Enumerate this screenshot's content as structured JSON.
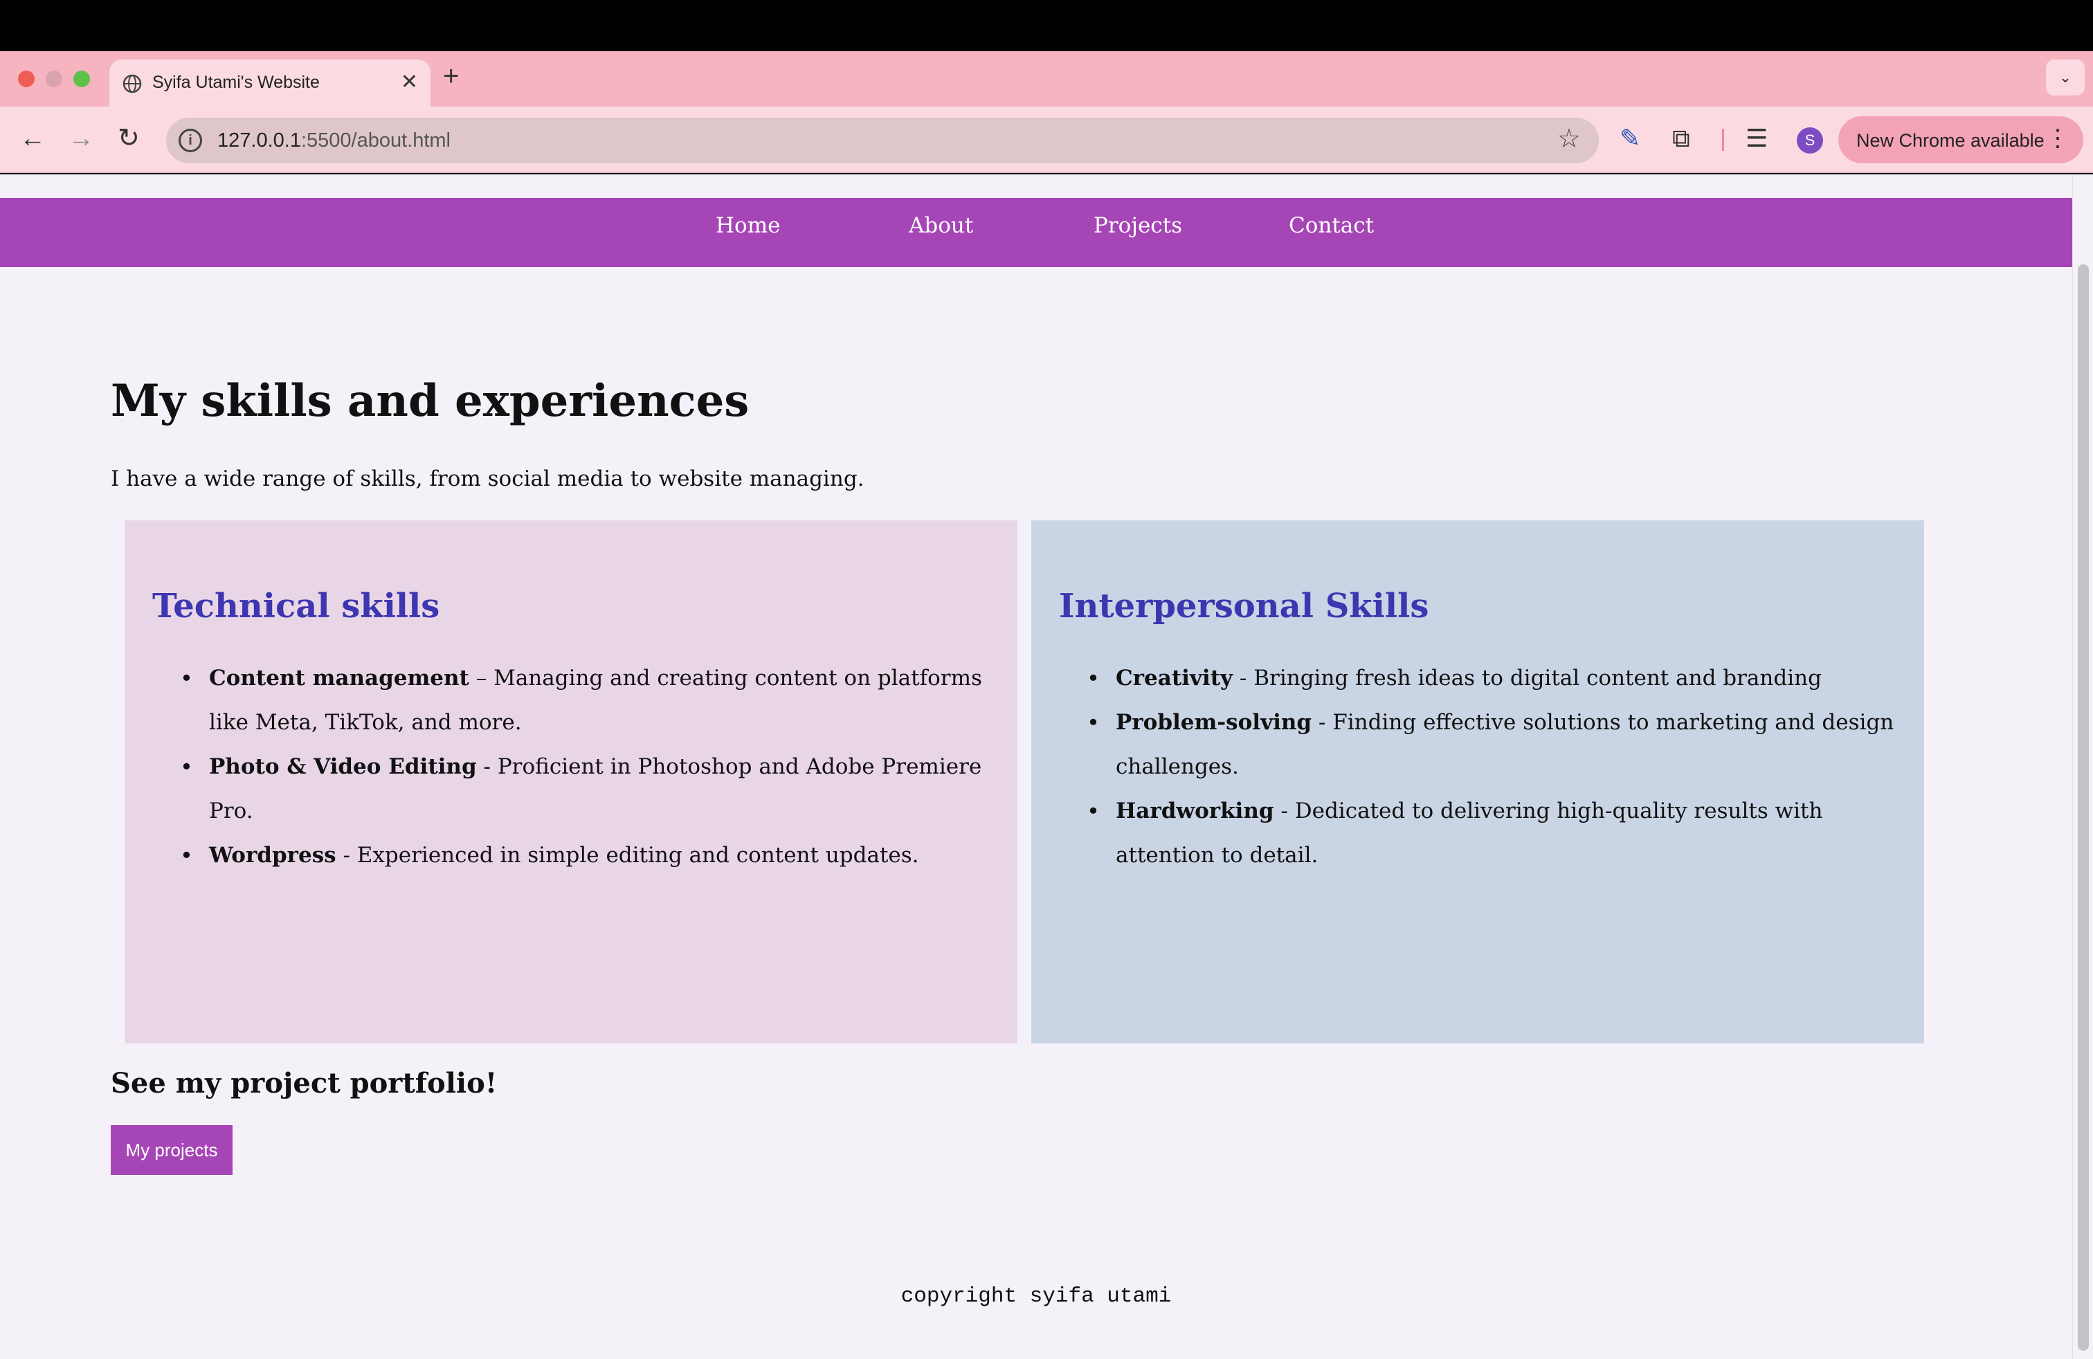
{
  "browser": {
    "tab_title": "Syifa Utami's Website",
    "new_tab_symbol": "+",
    "close_symbol": "✕",
    "url_host": "127.0.0.1",
    "url_path": ":5500/about.html",
    "update_button_label": "New Chrome available",
    "avatar_letter": "S",
    "icons": [
      "globe-icon",
      "back-icon",
      "forward-icon",
      "reload-icon",
      "info-icon",
      "star-icon",
      "pen-icon",
      "extensions-icon",
      "media-icon",
      "menu-icon",
      "tab-list-icon"
    ]
  },
  "nav": {
    "home": "Home",
    "about": "About",
    "projects": "Projects",
    "contact": "Contact"
  },
  "main": {
    "title": "My skills and experiences",
    "intro": "I have a wide range of skills, from social media to website managing."
  },
  "technical": {
    "heading": "Technical skills",
    "items": [
      {
        "name": "Content management",
        "desc": " – Managing and creating content on platforms like Meta, TikTok, and more."
      },
      {
        "name": "Photo & Video Editing",
        "desc": " - Proficient in Photoshop and Adobe Premiere Pro."
      },
      {
        "name": "Wordpress",
        "desc": " - Experienced in simple editing and content updates."
      }
    ]
  },
  "interpersonal": {
    "heading": "Interpersonal Skills",
    "items": [
      {
        "name": "Creativity",
        "desc": " - Bringing fresh ideas to digital content and branding"
      },
      {
        "name": "Problem-solving",
        "desc": " - Finding effective solutions to marketing and design challenges."
      },
      {
        "name": "Hardworking",
        "desc": " - Dedicated to delivering high-quality results with attention to detail."
      }
    ]
  },
  "portfolio": {
    "heading": "See my project portfolio!",
    "button_label": "My projects"
  },
  "footer": {
    "text": "copyright syifa utami"
  },
  "colors": {
    "nav_bg": "#a646b6",
    "tech_panel_bg": "#e8d6e7",
    "inter_panel_bg": "#c9d5e5",
    "heading_blue": "#3d36b0",
    "tabstrip_pink": "#f6b3c0"
  }
}
